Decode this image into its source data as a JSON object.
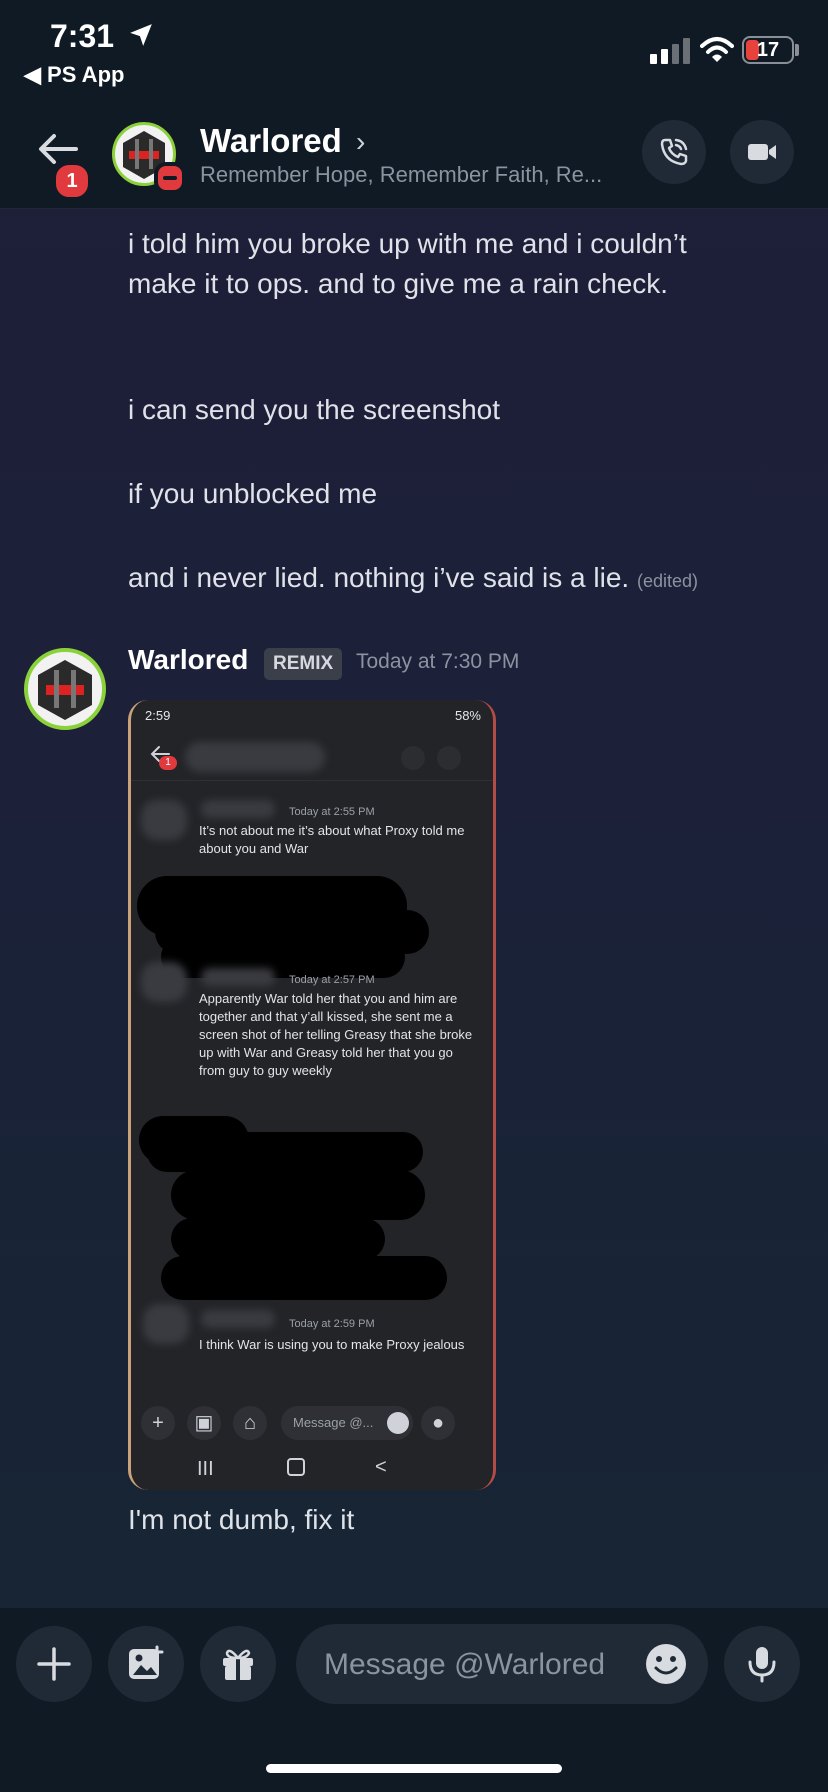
{
  "status_bar": {
    "time": "7:31",
    "back_app": "◀ PS App",
    "battery": "17"
  },
  "header": {
    "name": "Warlored",
    "chevron": "›",
    "status": "Remember Hope, Remember Faith, Re...",
    "badge_count": "1"
  },
  "messages": {
    "line1": "i told him you broke up with me and i couldn’t",
    "line2": "make it to ops. and to give me a rain check.",
    "line3": "i can send you the screenshot",
    "line4": "if you unblocked me",
    "line5": "and i never lied. nothing i’ve said is a lie.",
    "edited": "(edited)"
  },
  "post": {
    "author": "Warlored",
    "tag": "REMIX",
    "timestamp": "Today at 7:30 PM",
    "caption": "I'm not dumb, fix it"
  },
  "screenshot": {
    "time": "2:59",
    "sys": "58%",
    "badge": "1",
    "ts1": "Today at 2:55 PM",
    "text1": "It’s not about me it’s about what Proxy told me about you and War",
    "ts2": "Today at 2:57 PM",
    "text2": "Apparently War told her that you and him are together and that y’all kissed, she sent me a screen shot of her telling Greasy that she broke up with War and Greasy told her that you go from guy to guy weekly",
    "ts3": "Today at 2:59 PM",
    "text3": "I think War is using you to make Proxy jealous",
    "input_placeholder": "Message @...",
    "nav_recent": "III",
    "nav_back": "<"
  },
  "composer": {
    "placeholder": "Message @Warlored"
  }
}
